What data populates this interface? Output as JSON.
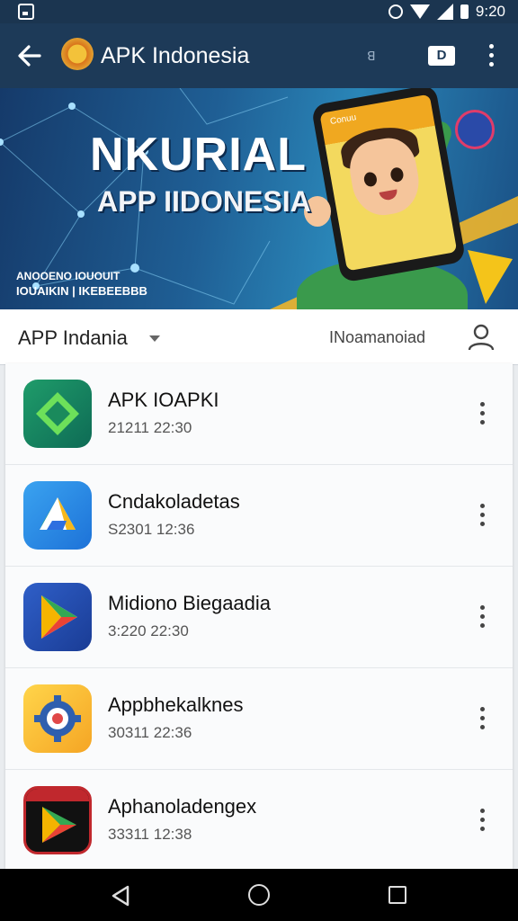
{
  "status_bar": {
    "time": "9:20"
  },
  "app_bar": {
    "title": "APK Indonesia",
    "small_mark": "ꓭ",
    "reader_label": "D"
  },
  "banner": {
    "headline": "NKURIAL",
    "subline": "APP IIDONESIA",
    "small_line1": "ANOOENO IOUOUIT",
    "small_line2": "IOUAIKIN | IKEBEEBBB",
    "phone_text": "Conuu"
  },
  "filter": {
    "selected": "APP Indania",
    "right_text": "INoamanoiad"
  },
  "apps": [
    {
      "name": "APK IOAPKI",
      "date": "21211 22:30",
      "icon": "green-diamond-icon"
    },
    {
      "name": "Cndakoladetas",
      "date": "S2301 12:36",
      "icon": "drive-triangle-icon"
    },
    {
      "name": "Midiono Biegaadia",
      "date": "3:220 22:30",
      "icon": "play-store-icon"
    },
    {
      "name": "Appbhekalknes",
      "date": "30311 22:36",
      "icon": "gear-badge-icon"
    },
    {
      "name": "Aphanoladengex",
      "date": "33311 12:38",
      "icon": "play-red-icon"
    }
  ],
  "colors": {
    "app_bar": "#1d3a58",
    "status_bar": "#1b3550",
    "list_bg": "#fafbfc"
  }
}
